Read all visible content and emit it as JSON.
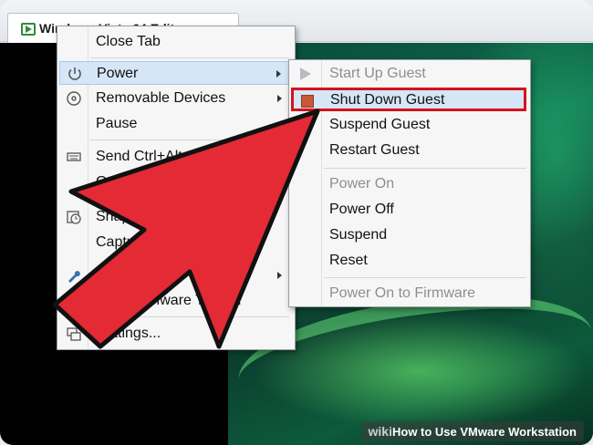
{
  "tab": {
    "title": "Windows Vista 64 Edit"
  },
  "main_menu": {
    "items": [
      {
        "label": "Close Tab"
      },
      {
        "label": "Power"
      },
      {
        "label": "Removable Devices"
      },
      {
        "label": "Pause"
      },
      {
        "label": "Send Ctrl+Alt+Del"
      },
      {
        "label": "Grab Input"
      },
      {
        "label": "Snapshot"
      },
      {
        "label": "Capture Screen"
      },
      {
        "label": "Manage"
      },
      {
        "label": "Install VMware Tools..."
      },
      {
        "label": "Settings..."
      }
    ]
  },
  "power_submenu": {
    "items": [
      {
        "label": "Start Up Guest"
      },
      {
        "label": "Shut Down Guest"
      },
      {
        "label": "Suspend Guest"
      },
      {
        "label": "Restart Guest"
      },
      {
        "label": "Power On"
      },
      {
        "label": "Power Off"
      },
      {
        "label": "Suspend"
      },
      {
        "label": "Reset"
      },
      {
        "label": "Power On to Firmware"
      }
    ]
  },
  "watermark": {
    "prefix": "wiki",
    "text": "How to Use VMware Workstation"
  },
  "colors": {
    "highlight": "#d5e6f7",
    "selection_border": "#d6121b",
    "arrow": "#e32a35"
  }
}
